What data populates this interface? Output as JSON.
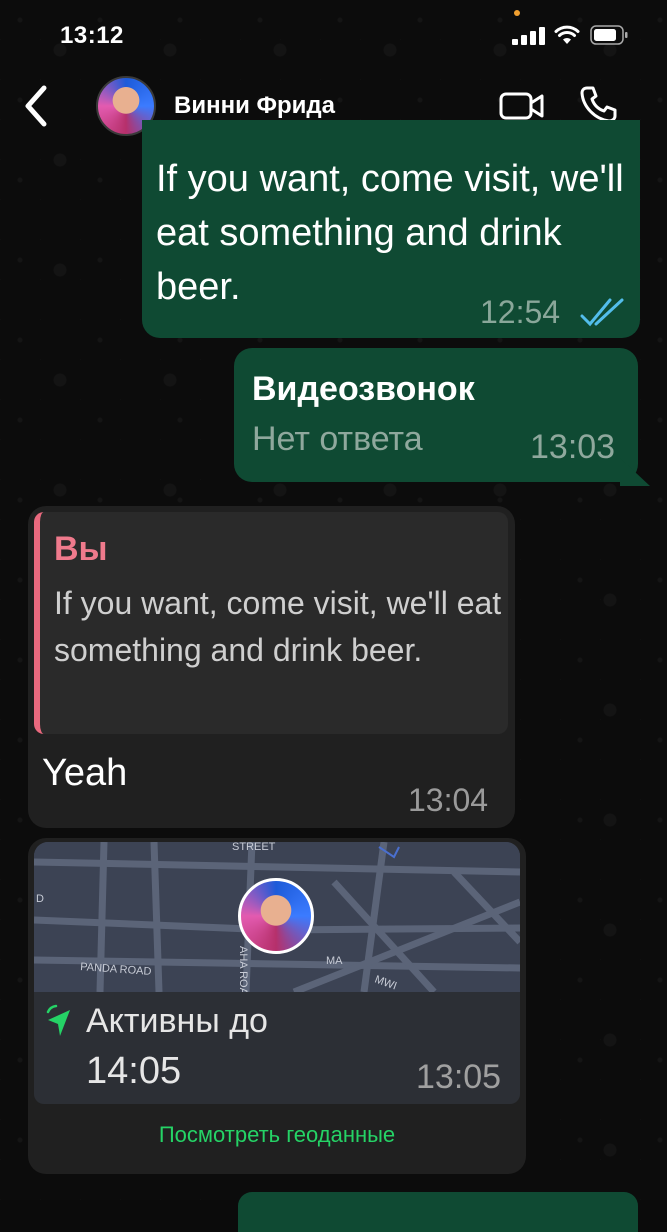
{
  "status_bar": {
    "time": "13:12"
  },
  "header": {
    "contact_name": "Винни Фрида"
  },
  "messages": [
    {
      "direction": "out",
      "text": "If you want, come visit, we'll eat something and drink beer.",
      "time": "12:54"
    },
    {
      "direction": "out",
      "title": "Видеозвонок",
      "subtitle": "Нет ответа",
      "time": "13:03"
    },
    {
      "direction": "in",
      "quote_author": "Вы",
      "quote_text": "If you want, come visit, we'll eat something and drink beer.",
      "text": "Yeah",
      "time": "13:04"
    },
    {
      "direction": "in",
      "live_label": "Активны до",
      "live_until": "14:05",
      "time": "13:05",
      "link_text": "Посмотреть геоданные",
      "map_labels": [
        "STREET",
        "D",
        "PANDA ROAD",
        "AHA ROA",
        "MA",
        "MWI"
      ]
    }
  ],
  "colors": {
    "accent_green": "#25d366",
    "outgoing_bubble": "#0f4a33",
    "incoming_bubble": "#202020",
    "read_ticks": "#53bdeb",
    "quote_author": "#ef7a8c"
  },
  "icons": [
    "back-chevron-icon",
    "video-camera-icon",
    "phone-icon",
    "double-check-icon",
    "live-location-icon"
  ]
}
